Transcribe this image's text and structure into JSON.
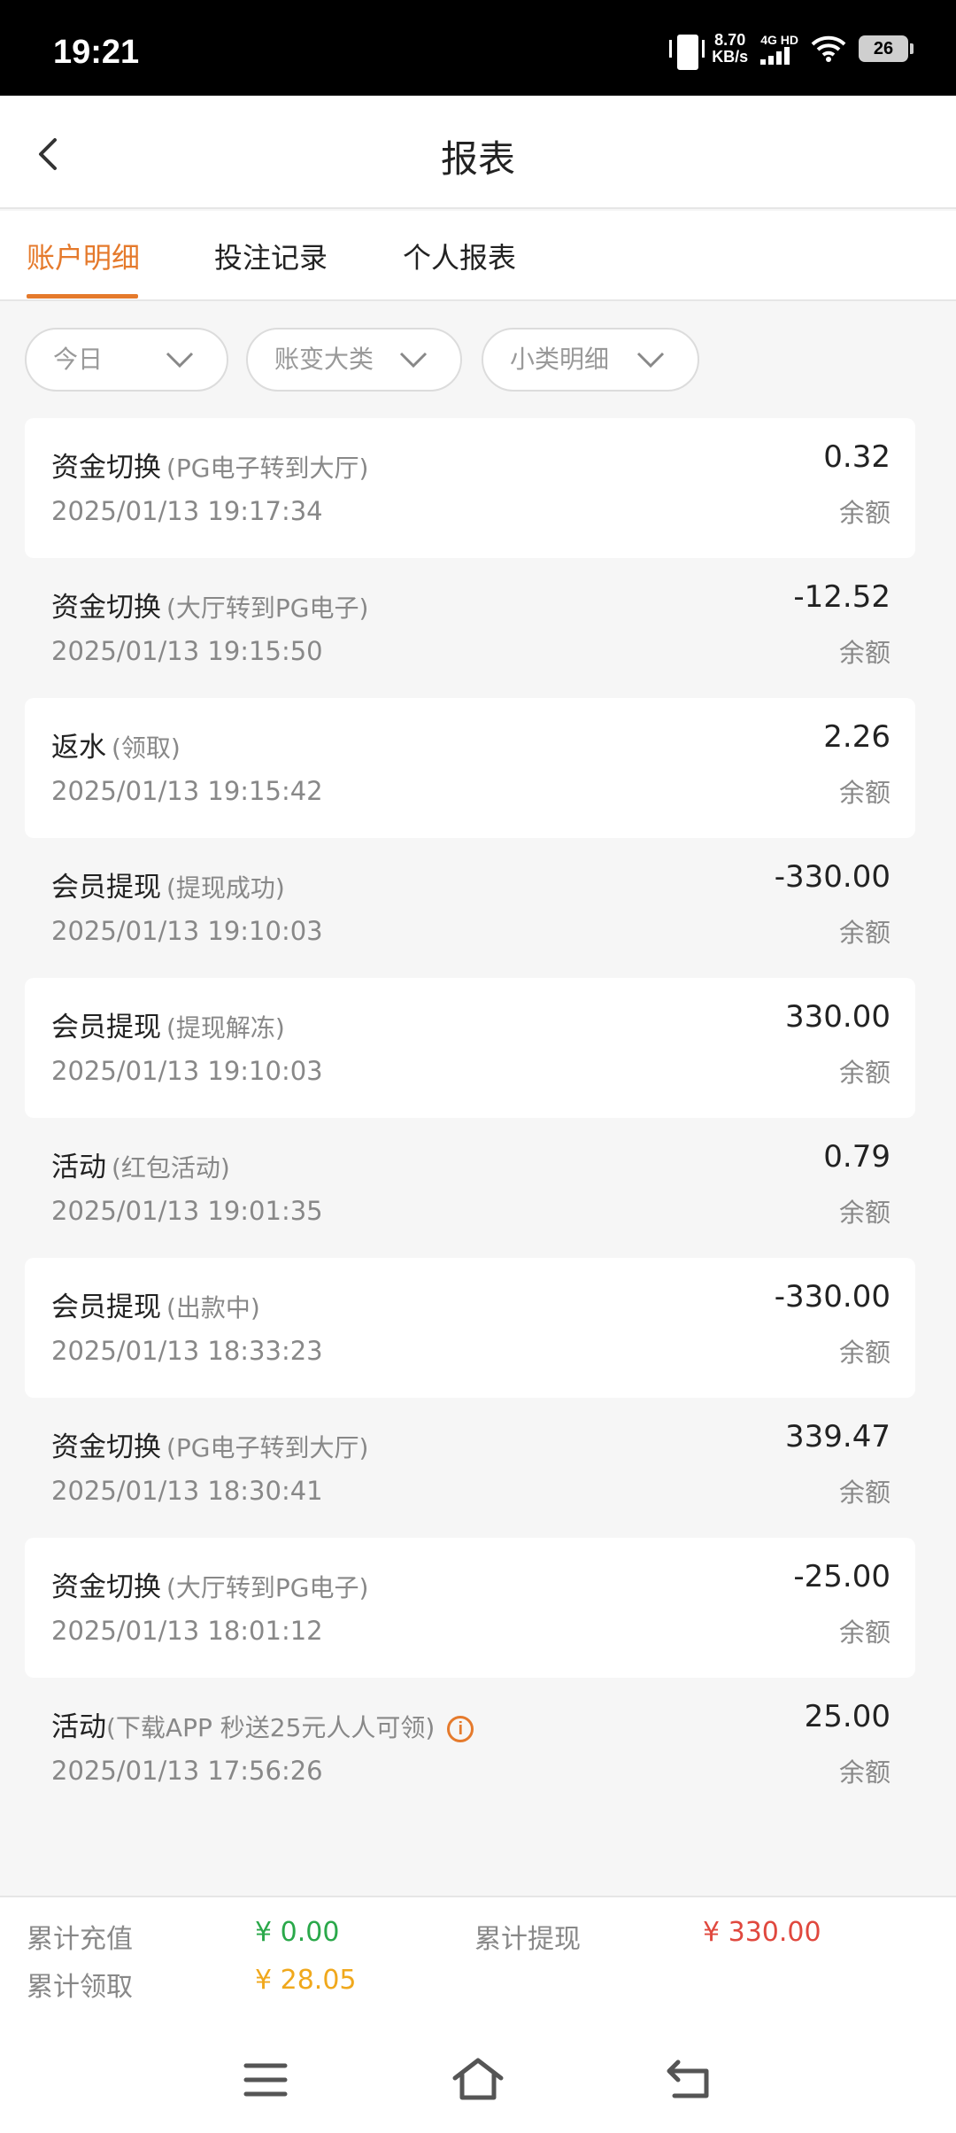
{
  "status_bar": {
    "time": "19:21",
    "speed_value": "8.70",
    "speed_unit": "KB/s",
    "network_label": "4G HD",
    "battery": "26"
  },
  "header": {
    "title": "报表"
  },
  "tabs": [
    {
      "label": "账户明细",
      "active": true
    },
    {
      "label": "投注记录",
      "active": false
    },
    {
      "label": "个人报表",
      "active": false
    }
  ],
  "filters": [
    {
      "label": "今日"
    },
    {
      "label": "账变大类"
    },
    {
      "label": "小类明细"
    }
  ],
  "transactions": [
    {
      "title": "资金切换",
      "detail": "(PG电子转到大厅)",
      "date": "2025/01/13 19:17:34",
      "amount": "0.32",
      "balance_label": "余额"
    },
    {
      "title": "资金切换",
      "detail": "(大厅转到PG电子)",
      "date": "2025/01/13 19:15:50",
      "amount": "-12.52",
      "balance_label": "余额"
    },
    {
      "title": "返水",
      "detail": "(领取)",
      "date": "2025/01/13 19:15:42",
      "amount": "2.26",
      "balance_label": "余额"
    },
    {
      "title": "会员提现",
      "detail": "(提现成功)",
      "date": "2025/01/13 19:10:03",
      "amount": "-330.00",
      "balance_label": "余额"
    },
    {
      "title": "会员提现",
      "detail": "(提现解冻)",
      "date": "2025/01/13 19:10:03",
      "amount": "330.00",
      "balance_label": "余额"
    },
    {
      "title": "活动",
      "detail": "(红包活动)",
      "date": "2025/01/13 19:01:35",
      "amount": "0.79",
      "balance_label": "余额"
    },
    {
      "title": "会员提现",
      "detail": "(出款中)",
      "date": "2025/01/13 18:33:23",
      "amount": "-330.00",
      "balance_label": "余额"
    },
    {
      "title": "资金切换",
      "detail": "(PG电子转到大厅)",
      "date": "2025/01/13 18:30:41",
      "amount": "339.47",
      "balance_label": "余额"
    },
    {
      "title": "资金切换",
      "detail": "(大厅转到PG电子)",
      "date": "2025/01/13 18:01:12",
      "amount": "-25.00",
      "balance_label": "余额"
    },
    {
      "title": "活动",
      "detail": "(下载APP 秒送25元人人可领)",
      "date": "2025/01/13 17:56:26",
      "amount": "25.00",
      "balance_label": "余额"
    }
  ],
  "summary": {
    "recharge_label": "累计充值",
    "recharge_value": "¥ 0.00",
    "withdraw_label": "累计提现",
    "withdraw_value": "¥ 330.00",
    "claim_label": "累计领取",
    "claim_value": "¥ 28.05"
  },
  "colors": {
    "accent": "#e57a2c",
    "green": "#2aa84a",
    "red": "#e0483e",
    "yellow": "#f0a81c"
  },
  "icons": {
    "back": "chevron-left-icon",
    "dropdown": "chevron-down-icon",
    "info": "info-icon",
    "menu": "menu-icon",
    "home": "home-icon",
    "return": "return-icon"
  }
}
